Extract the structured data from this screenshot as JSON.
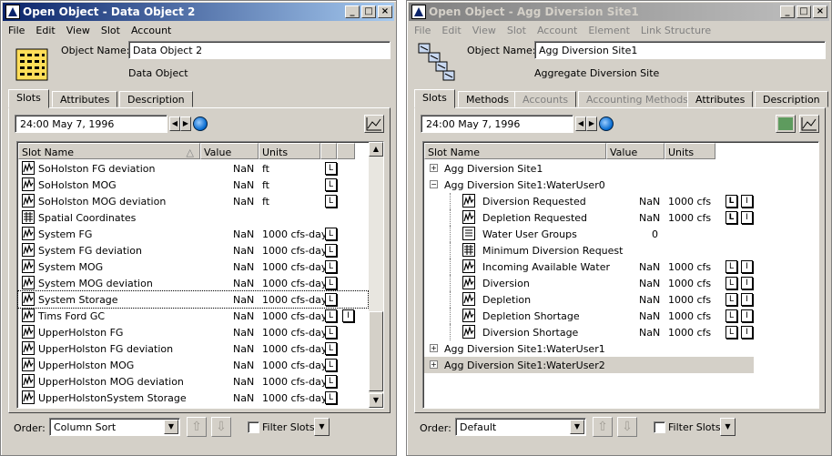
{
  "left": {
    "title": "Open Object - Data Object 2",
    "menu": [
      "File",
      "Edit",
      "View",
      "Slot",
      "Account"
    ],
    "object_name_label": "Object Name:",
    "object_name_value": "Data Object 2",
    "object_type": "Data Object",
    "tabs": [
      "Slots",
      "Attributes",
      "Description"
    ],
    "date": "24:00 May 7, 1996",
    "columns": [
      "Slot Name",
      "Value",
      "Units"
    ],
    "rows": [
      {
        "name": "SoHolston FG deviation",
        "icon": "series-slot-icon",
        "value": "NaN",
        "units": "ft",
        "b1": "L",
        "b2": ""
      },
      {
        "name": "SoHolston MOG",
        "icon": "series-slot-icon",
        "value": "NaN",
        "units": "ft",
        "b1": "L",
        "b2": ""
      },
      {
        "name": "SoHolston MOG deviation",
        "icon": "series-slot-icon",
        "value": "NaN",
        "units": "ft",
        "b1": "L",
        "b2": ""
      },
      {
        "name": "Spatial Coordinates",
        "icon": "table-slot-icon",
        "value": "",
        "units": "",
        "b1": "",
        "b2": ""
      },
      {
        "name": "System FG",
        "icon": "series-slot-icon",
        "value": "NaN",
        "units": "1000 cfs-day",
        "b1": "L",
        "b2": ""
      },
      {
        "name": "System FG deviation",
        "icon": "series-slot-icon",
        "value": "NaN",
        "units": "1000 cfs-day",
        "b1": "L",
        "b2": ""
      },
      {
        "name": "System MOG",
        "icon": "series-slot-icon",
        "value": "NaN",
        "units": "1000 cfs-day",
        "b1": "L",
        "b2": ""
      },
      {
        "name": "System MOG deviation",
        "icon": "series-slot-icon",
        "value": "NaN",
        "units": "1000 cfs-day",
        "b1": "L",
        "b2": ""
      },
      {
        "name": "System Storage",
        "icon": "series-slot-icon",
        "value": "NaN",
        "units": "1000 cfs-day",
        "b1": "L",
        "b2": ""
      },
      {
        "name": "Tims Ford GC",
        "icon": "series-slot-icon",
        "value": "NaN",
        "units": "1000 cfs-day",
        "b1": "L",
        "b2": "I"
      },
      {
        "name": "UpperHolston FG",
        "icon": "series-slot-icon",
        "value": "NaN",
        "units": "1000 cfs-day",
        "b1": "L",
        "b2": ""
      },
      {
        "name": "UpperHolston FG deviation",
        "icon": "series-slot-icon",
        "value": "NaN",
        "units": "1000 cfs-day",
        "b1": "L",
        "b2": ""
      },
      {
        "name": "UpperHolston MOG",
        "icon": "series-slot-icon",
        "value": "NaN",
        "units": "1000 cfs-day",
        "b1": "L",
        "b2": ""
      },
      {
        "name": "UpperHolston MOG deviation",
        "icon": "series-slot-icon",
        "value": "NaN",
        "units": "1000 cfs-day",
        "b1": "L",
        "b2": ""
      },
      {
        "name": "UpperHolstonSystem Storage",
        "icon": "series-slot-icon",
        "value": "NaN",
        "units": "1000 cfs-day",
        "b1": "L",
        "b2": ""
      }
    ],
    "order_label": "Order:",
    "order_value": "Column Sort",
    "filter_label": "Filter Slots"
  },
  "right": {
    "title": "Open Object - Agg Diversion Site1",
    "menu": [
      "File",
      "Edit",
      "View",
      "Slot",
      "Account",
      "Element",
      "Link Structure"
    ],
    "object_name_label": "Object Name:",
    "object_name_value": "Agg Diversion Site1",
    "object_type": "Aggregate Diversion Site",
    "tabs": [
      "Slots",
      "Methods",
      "Accounts",
      "Accounting Methods",
      "Attributes",
      "Description"
    ],
    "date": "24:00 May 7, 1996",
    "columns": [
      "Slot Name",
      "Value",
      "Units"
    ],
    "tree": [
      {
        "name": "Agg Diversion Site1",
        "toggle": "+",
        "level": 0
      },
      {
        "name": "Agg Diversion Site1:WaterUser0",
        "toggle": "−",
        "level": 0
      },
      {
        "name": "Diversion Requested",
        "icon": "series-slot-icon",
        "value": "NaN",
        "units": "1000 cfs",
        "b1": "L",
        "b2": "I",
        "level": 1
      },
      {
        "name": "Depletion Requested",
        "icon": "series-slot-icon",
        "value": "NaN",
        "units": "1000 cfs",
        "b1": "L",
        "b2": "I",
        "level": 1
      },
      {
        "name": "Water User Groups",
        "icon": "list-slot-icon",
        "value": "0",
        "units": "",
        "b1": "",
        "b2": "",
        "level": 1
      },
      {
        "name": "Minimum Diversion Request",
        "icon": "table-slot-icon",
        "value": "",
        "units": "",
        "b1": "",
        "b2": "",
        "level": 1
      },
      {
        "name": "Incoming Available Water",
        "icon": "series-slot-icon",
        "value": "NaN",
        "units": "1000 cfs",
        "b1": "L",
        "b2": "I",
        "level": 1
      },
      {
        "name": "Diversion",
        "icon": "series-slot-icon",
        "value": "NaN",
        "units": "1000 cfs",
        "b1": "L",
        "b2": "I",
        "level": 1
      },
      {
        "name": "Depletion",
        "icon": "series-slot-icon",
        "value": "NaN",
        "units": "1000 cfs",
        "b1": "L",
        "b2": "I",
        "level": 1
      },
      {
        "name": "Depletion Shortage",
        "icon": "series-slot-icon",
        "value": "NaN",
        "units": "1000 cfs",
        "b1": "L",
        "b2": "I",
        "level": 1
      },
      {
        "name": "Diversion Shortage",
        "icon": "series-slot-icon",
        "value": "NaN",
        "units": "1000 cfs",
        "b1": "L",
        "b2": "I",
        "level": 1
      },
      {
        "name": "Agg Diversion Site1:WaterUser1",
        "toggle": "+",
        "level": 0
      },
      {
        "name": "Agg Diversion Site1:WaterUser2",
        "toggle": "+",
        "level": 0
      }
    ],
    "order_label": "Order:",
    "order_value": "Default",
    "filter_label": "Filter Slots"
  }
}
